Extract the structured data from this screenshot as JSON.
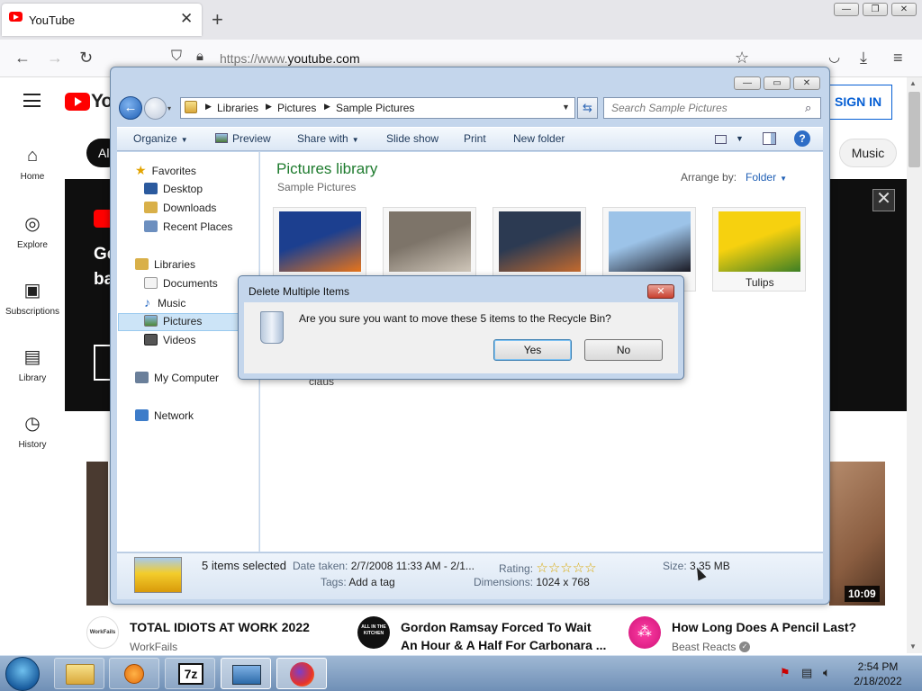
{
  "browser": {
    "tab_title": "YouTube",
    "tab_close": "✕",
    "new_tab": "+",
    "url_prefix": "https://www.",
    "url_domain": "youtube.com",
    "window_controls": [
      "—",
      "❐",
      "✕"
    ]
  },
  "youtube": {
    "logo_text": "Yo",
    "sign_in": "SIGN IN",
    "chip_all": "Al",
    "chip_music": "Music",
    "sidebar": [
      {
        "label": "Home",
        "icon": "home-icon",
        "glyph": "⌂"
      },
      {
        "label": "Explore",
        "icon": "compass-icon",
        "glyph": "◎"
      },
      {
        "label": "Subscriptions",
        "icon": "subscriptions-icon",
        "glyph": "▣"
      },
      {
        "label": "Library",
        "icon": "library-icon",
        "glyph": "▤"
      },
      {
        "label": "History",
        "icon": "history-icon",
        "glyph": "◷"
      }
    ],
    "banner": {
      "line1": "Ge",
      "line2": "ba",
      "close": "✕"
    },
    "duration": "10:09",
    "videos": [
      {
        "title_line1": "TOTAL IDIOTS AT WORK 2022",
        "title_line2": "",
        "channel": "WorkFails",
        "avatar_text": "WorkFails",
        "verified": false
      },
      {
        "title_line1": "Gordon Ramsay Forced To Wait",
        "title_line2": "An Hour & A Half For Carbonara ...",
        "channel": "",
        "avatar_text": "ALL IN THE KITCHEN",
        "verified": false
      },
      {
        "title_line1": "How Long Does A Pencil Last?",
        "title_line2": "",
        "channel": "Beast Reacts",
        "avatar_text": "",
        "verified": true
      }
    ]
  },
  "explorer": {
    "breadcrumb": [
      "Libraries",
      "Pictures",
      "Sample Pictures"
    ],
    "search_placeholder": "Search Sample Pictures",
    "toolbar": {
      "organize": "Organize",
      "preview": "Preview",
      "share_with": "Share with",
      "slide_show": "Slide show",
      "print": "Print",
      "new_folder": "New folder",
      "help": "?"
    },
    "nav": {
      "favorites": "Favorites",
      "desktop": "Desktop",
      "downloads": "Downloads",
      "recent_places": "Recent Places",
      "libraries": "Libraries",
      "documents": "Documents",
      "music": "Music",
      "pictures": "Pictures",
      "videos": "Videos",
      "my_computer": "My Computer",
      "network": "Network"
    },
    "library_title": "Pictures library",
    "library_subtitle": "Sample Pictures",
    "arrange_label": "Arrange by:",
    "arrange_value": "Folder",
    "thumbnails": [
      {
        "label": "",
        "colors": [
          "#1c3f8f",
          "#e8741a"
        ]
      },
      {
        "label": "",
        "colors": [
          "#7d7469",
          "#cfc6b9"
        ]
      },
      {
        "label": "",
        "colors": [
          "#2c3a52",
          "#c46a2e"
        ]
      },
      {
        "label": "",
        "colors": [
          "#9cc3e8",
          "#1a1a24"
        ]
      },
      {
        "label": "Tulips",
        "colors": [
          "#f6d10f",
          "#3d7f24"
        ]
      }
    ],
    "partial_label": "claus",
    "details": {
      "selected": "5 items selected",
      "date_taken_label": "Date taken:",
      "date_taken_value": "2/7/2008 11:33 AM - 2/1...",
      "tags_label": "Tags:",
      "tags_value": "Add a tag",
      "rating_label": "Rating:",
      "rating_stars": "☆☆☆☆☆",
      "dimensions_label": "Dimensions:",
      "dimensions_value": "1024 x 768",
      "size_label": "Size:",
      "size_value": "3.35 MB"
    }
  },
  "dialog": {
    "title": "Delete Multiple Items",
    "message": "Are you sure you want to move these 5 items to the Recycle Bin?",
    "yes": "Yes",
    "no": "No",
    "close": "✕"
  },
  "taskbar": {
    "time": "2:54 PM",
    "date": "2/18/2022",
    "apps": [
      "explorer",
      "media-player",
      "7-zip",
      "photo-viewer",
      "firefox"
    ],
    "app_7zip_label": "7z"
  }
}
